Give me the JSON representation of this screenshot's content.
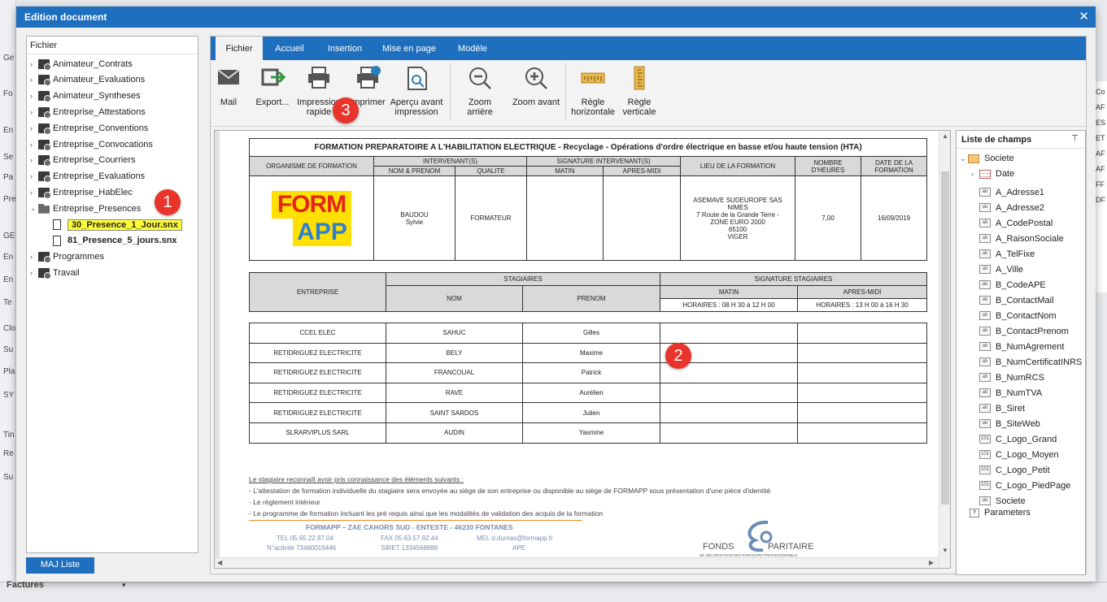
{
  "background": {
    "left_letters": [
      "Ge",
      "Fo",
      "En",
      "Se",
      "Pa",
      "Pre",
      "GE",
      "En",
      "En",
      "Te",
      "Clo",
      "Su",
      "Pla",
      "SY",
      "Tin",
      "Re",
      "Su"
    ],
    "right_letters": [
      "Co",
      "AF",
      "ES",
      "ET",
      "AF",
      "AF",
      "FF",
      "DF"
    ],
    "bottom_label": "Factures"
  },
  "dialog": {
    "title": "Edition document",
    "close_icon": "close-icon"
  },
  "tree": {
    "header": "Fichier",
    "items": [
      {
        "label": "Animateur_Contrats"
      },
      {
        "label": "Animateur_Evaluations"
      },
      {
        "label": "Animateur_Syntheses"
      },
      {
        "label": "Entreprise_Attestations"
      },
      {
        "label": "Entreprise_Conventions"
      },
      {
        "label": "Entreprise_Convocations"
      },
      {
        "label": "Entreprise_Courriers"
      },
      {
        "label": "Entreprise_Evaluations"
      },
      {
        "label": "Entreprise_HabElec"
      },
      {
        "label": "Entreprise_Presences"
      },
      {
        "label": "30_Presence_1_Jour.snx"
      },
      {
        "label": "81_Presence_5_jours.snx"
      },
      {
        "label": "Programmes"
      },
      {
        "label": "Travail"
      }
    ],
    "maj_button": "MAJ Liste"
  },
  "tabs": [
    "Fichier",
    "Accueil",
    "Insertion",
    "Mise en page",
    "Modèle"
  ],
  "ribbon": [
    {
      "label": "Mail",
      "icon": "mail-icon"
    },
    {
      "label": "Export...",
      "icon": "export-icon"
    },
    {
      "label": "Impression\nrapide",
      "icon": "quick-print-icon"
    },
    {
      "label": "Imprimer",
      "icon": "print-icon"
    },
    {
      "label": "Aperçu avant\nimpression",
      "icon": "print-preview-icon"
    },
    {
      "label": "Zoom arrière",
      "icon": "zoom-out-icon"
    },
    {
      "label": "Zoom avant",
      "icon": "zoom-in-icon"
    },
    {
      "label": "Règle\nhorizontale",
      "icon": "horizontal-ruler-icon"
    },
    {
      "label": "Règle\nverticale",
      "icon": "vertical-ruler-icon"
    }
  ],
  "document": {
    "title": "FORMATION PREPARATOIRE A L'HABILITATION ELECTRIQUE - Recyclage - Opérations d'ordre électrique en basse et/ou haute tension (HTA)",
    "h_org": "ORGANISME DE FORMATION",
    "h_intervenants": "INTERVENANT(S)",
    "h_sig_intervenant": "SIGNATURE INTERVENANT(S)",
    "h_lieu": "LIEU DE LA FORMATION",
    "h_nombre": "NOMBRE D'HEURES",
    "h_date": "DATE DE LA FORMATION",
    "h_nom_prenom": "NOM & PRENOM",
    "h_qualite": "QUALITE",
    "h_matin": "MATIN",
    "h_apresmidi": "APRES-MIDI",
    "logo_top": "FORM",
    "logo_bottom": "APP",
    "intervenant": "BAUDOU\nSylvie",
    "qualite": "FORMATEUR",
    "lieu": "ASEMAVE SUDEUROPE SAS\nNIMES\n7 Route de la Grande Terre -\nZONE EURO 2000\n65100\nVIGER",
    "heures": "7,00",
    "date": "16/09/2019",
    "h_entreprise": "ENTREPRISE",
    "h_stagiaires": "STAGIAIRES",
    "h_sig_stagiaires": "SIGNATURE STAGIAIRES",
    "h_nom": "NOM",
    "h_prenom": "PRENOM",
    "horaires_matin": "HORAIRES : 08 H 30 à 12 H 00",
    "horaires_am": "HORAIRES : 13 H 00 à 16 H 30",
    "rows": [
      {
        "entreprise": "CCEL ELEC",
        "nom": "SAHUC",
        "prenom": "Gilles"
      },
      {
        "entreprise": "RETIDRIGUEZ ELECTRICITE",
        "nom": "BELY",
        "prenom": "Maxime"
      },
      {
        "entreprise": "RETIDRIGUEZ ELECTRICITE",
        "nom": "FRANCOUAL",
        "prenom": "Patrick"
      },
      {
        "entreprise": "RETIDRIGUEZ ELECTRICITE",
        "nom": "RAVE",
        "prenom": "Aurélien"
      },
      {
        "entreprise": "RETIDRIGUEZ ELECTRICITE",
        "nom": "SAINT SARDOS",
        "prenom": "Julien"
      },
      {
        "entreprise": "SLRARVIPLUS SARL",
        "nom": "AUDIN",
        "prenom": "Yasmine"
      }
    ],
    "notes": [
      "Le stagiaire reconnaît avoir pris connaissance des éléments suivants :",
      "- L'attestation de formation individuelle du stagiaire sera envoyée au siège de son entreprise ou disponible au siège de FORMAPP sous présentation d'une pièce d'identité",
      "- Le règlement intérieur",
      "- Le programme de formation incluant les pré requis ainsi que les modalités de validation des acquis de la formation"
    ],
    "footer_title": "FORMAPP – ZAE CAHORS SUD - ENTESTE - 46230 FONTANES",
    "footer_tel": "TEL 05.65.22.87.04",
    "footer_fax": "FAX 05.63.57.62.44",
    "footer_mel": "MEL d.dumas@formapp.fr",
    "footer_activite": "N°activité 73460016446",
    "footer_siret": "SIRET 1334568888",
    "footer_ape": "APE",
    "fonds_left": "FONDS",
    "fonds_right": "PARITAIRE",
    "fonds_sub": "DE SÉCURISATION DES PARCOURS PROFESSIONNELS"
  },
  "fields": {
    "header": "Liste de champs",
    "pin_icon": "pin-icon",
    "root": "Societe",
    "date_node": "Date",
    "items": [
      "A_Adresse1",
      "A_Adresse2",
      "A_CodePostal",
      "A_RaisonSociale",
      "A_TelFixe",
      "A_Ville",
      "B_CodeAPE",
      "B_ContactMail",
      "B_ContactNom",
      "B_ContactPrenom",
      "B_NumAgrement",
      "B_NumCertificatINRS",
      "B_NumRCS",
      "B_NumTVA",
      "B_Siret",
      "B_SiteWeb",
      "C_Logo_Grand",
      "C_Logo_Moyen",
      "C_Logo_Petit",
      "C_Logo_PiedPage",
      "Societe"
    ],
    "parameters": "Parameters"
  },
  "badges": [
    "1",
    "2",
    "3"
  ],
  "colors": {
    "accent": "#1f6fbf",
    "selection": "#ffff33",
    "badge": "#e8342b"
  }
}
